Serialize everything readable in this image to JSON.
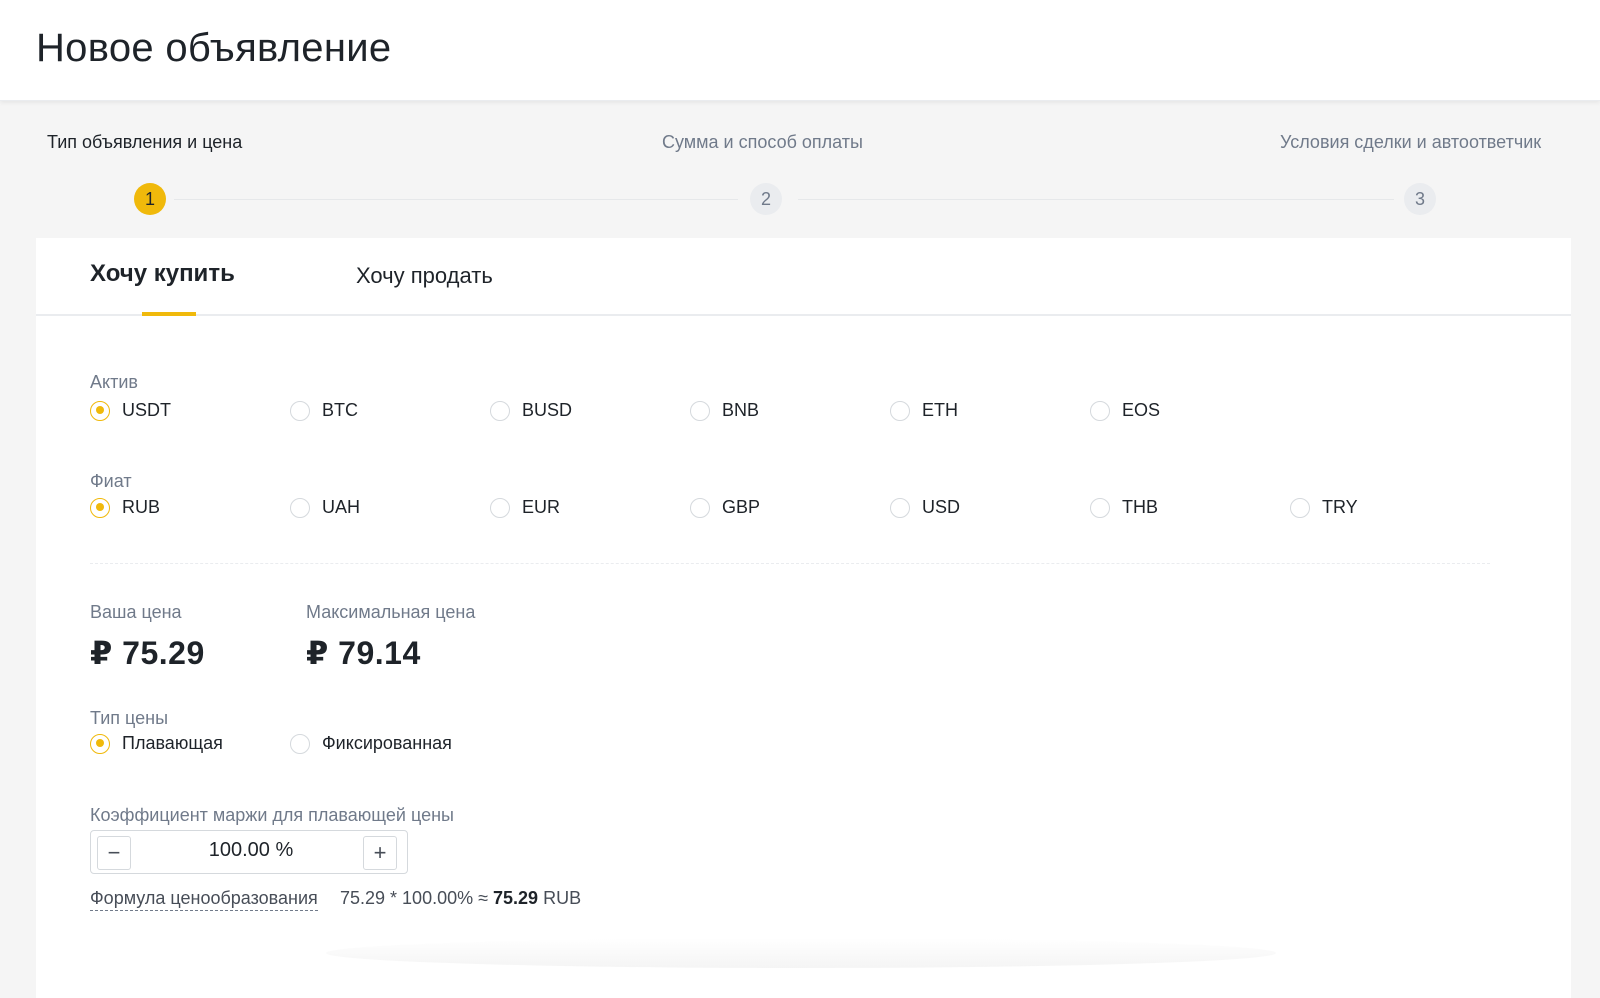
{
  "header": {
    "title": "Новое объявление"
  },
  "stepper": {
    "steps": [
      {
        "number": "1",
        "label": "Тип объявления и цена"
      },
      {
        "number": "2",
        "label": "Сумма и способ оплаты"
      },
      {
        "number": "3",
        "label": "Условия сделки и автоответчик"
      }
    ]
  },
  "tabs": {
    "buy": "Хочу купить",
    "sell": "Хочу продать"
  },
  "asset": {
    "label": "Актив",
    "options": [
      "USDT",
      "BTC",
      "BUSD",
      "BNB",
      "ETH",
      "EOS"
    ],
    "selected": "USDT"
  },
  "fiat": {
    "label": "Фиат",
    "options": [
      "RUB",
      "UAH",
      "EUR",
      "GBP",
      "USD",
      "THB",
      "TRY"
    ],
    "selected": "RUB"
  },
  "prices": {
    "your_label": "Ваша цена",
    "your_value": "₽ 75.29",
    "max_label": "Максимальная цена",
    "max_value": "₽ 79.14"
  },
  "price_type": {
    "label": "Тип цены",
    "options": [
      "Плавающая",
      "Фиксированная"
    ],
    "selected": "Плавающая"
  },
  "margin": {
    "label": "Коэффициент маржи для плавающей цены",
    "value": "100.00 %",
    "minus": "−",
    "plus": "+"
  },
  "formula": {
    "link": "Формула ценообразования",
    "expression": "75.29 * 100.00% ≈",
    "result": "75.29",
    "currency": "RUB"
  },
  "colors": {
    "accent": "#f0b90b",
    "text": "#1e2329",
    "muted": "#707a8a"
  }
}
